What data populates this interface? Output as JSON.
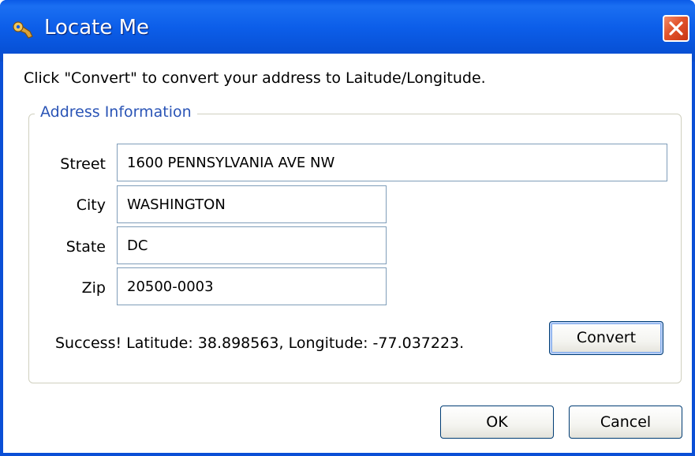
{
  "window": {
    "title": "Locate Me",
    "title_icon": "wrench-icon",
    "close_icon": "close-icon"
  },
  "instructions": "Click \"Convert\" to convert your address to Laitude/Longitude.",
  "address_group": {
    "legend": "Address Information",
    "fields": {
      "street": {
        "label": "Street",
        "value": "1600 PENNSYLVANIA AVE NW"
      },
      "city": {
        "label": "City",
        "value": "WASHINGTON"
      },
      "state": {
        "label": "State",
        "value": "DC"
      },
      "zip": {
        "label": "Zip",
        "value": "20500-0003"
      }
    },
    "status": "Success! Latitude: 38.898563, Longitude: -77.037223.",
    "convert_label": "Convert"
  },
  "buttons": {
    "ok_label": "OK",
    "cancel_label": "Cancel"
  },
  "colors": {
    "titlebar": "#0a5be7",
    "legend_text": "#2a54b6",
    "close_button": "#e2532b"
  }
}
